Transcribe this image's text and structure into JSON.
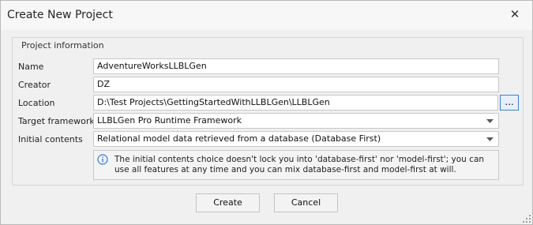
{
  "window": {
    "title": "Create New Project"
  },
  "group": {
    "label": "Project information"
  },
  "rows": {
    "name": {
      "label": "Name",
      "value": "AdventureWorksLLBLGen"
    },
    "creator": {
      "label": "Creator",
      "value": "DZ"
    },
    "location": {
      "label": "Location",
      "value": "D:\\Test Projects\\GettingStartedWithLLBLGen\\LLBLGen",
      "browse_label": "..."
    },
    "framework": {
      "label": "Target framework",
      "value": "LLBLGen Pro Runtime Framework"
    },
    "contents": {
      "label": "Initial contents",
      "value": "Relational model data retrieved from a database (Database First)"
    }
  },
  "info": {
    "text": "The initial contents choice doesn't lock you into 'database-first' nor 'model-first'; you can use all features at any time and you can mix database-first and model-first at will."
  },
  "buttons": {
    "create": "Create",
    "cancel": "Cancel"
  },
  "colors": {
    "accent": "#3c7fd1",
    "info_icon": "#2f7cd6"
  }
}
